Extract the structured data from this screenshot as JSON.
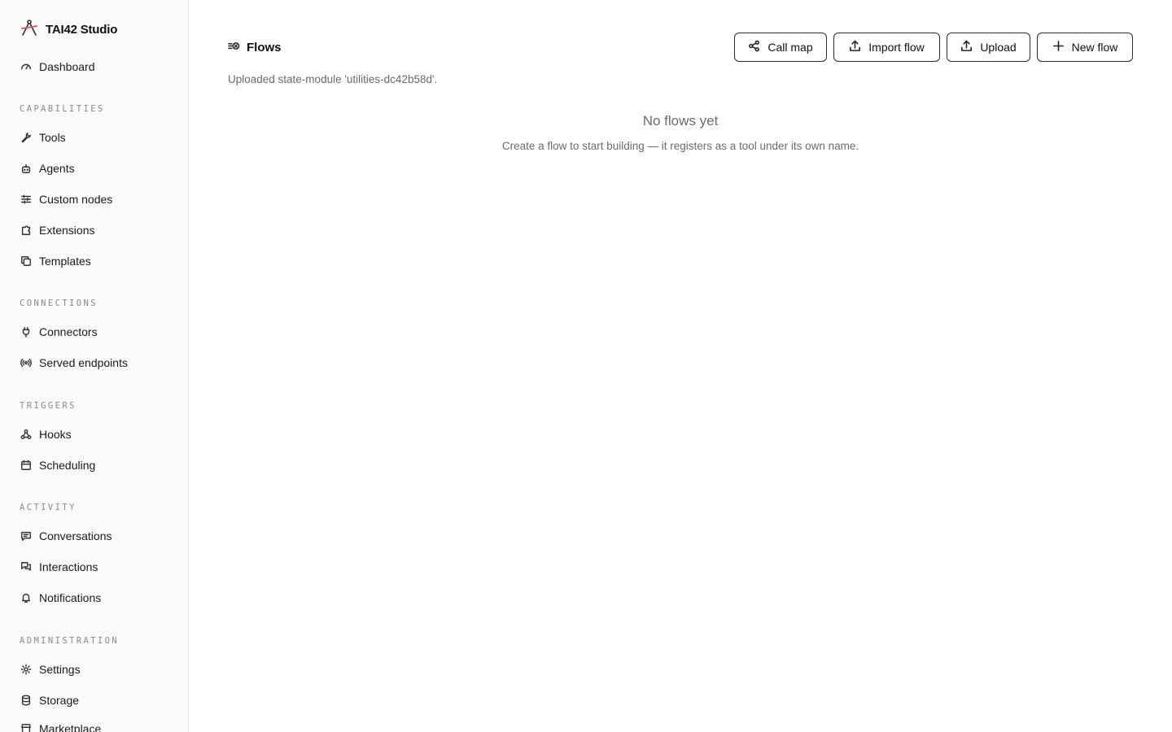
{
  "app": {
    "title": "TAI42 Studio",
    "logo_icon": "compass-logo-icon",
    "accent_color": "#d9534f"
  },
  "sidebar": {
    "dashboard": {
      "label": "Dashboard",
      "icon": "gauge-icon"
    },
    "sections": [
      {
        "heading": "CAPABILITIES",
        "items": [
          {
            "label": "Tools",
            "icon": "wrench-icon"
          },
          {
            "label": "Agents",
            "icon": "robot-icon"
          },
          {
            "label": "Custom nodes",
            "icon": "sliders-icon"
          },
          {
            "label": "Extensions",
            "icon": "puzzle-icon"
          },
          {
            "label": "Templates",
            "icon": "copy-icon"
          }
        ]
      },
      {
        "heading": "CONNECTIONS",
        "items": [
          {
            "label": "Connectors",
            "icon": "plug-icon"
          },
          {
            "label": "Served endpoints",
            "icon": "broadcast-icon"
          }
        ]
      },
      {
        "heading": "TRIGGERS",
        "items": [
          {
            "label": "Hooks",
            "icon": "webhook-icon"
          },
          {
            "label": "Scheduling",
            "icon": "calendar-icon"
          }
        ]
      },
      {
        "heading": "ACTIVITY",
        "items": [
          {
            "label": "Conversations",
            "icon": "message-square-icon"
          },
          {
            "label": "Interactions",
            "icon": "messages-icon"
          },
          {
            "label": "Notifications",
            "icon": "bell-icon"
          }
        ]
      },
      {
        "heading": "ADMINISTRATION",
        "items": [
          {
            "label": "Settings",
            "icon": "gear-icon"
          },
          {
            "label": "Storage",
            "icon": "database-icon"
          },
          {
            "label": "Marketplace",
            "icon": "store-icon"
          }
        ]
      }
    ]
  },
  "header": {
    "title": "Flows",
    "title_icon": "flows-icon",
    "buttons": {
      "call_map": {
        "label": "Call map",
        "icon": "share-icon"
      },
      "import_flow": {
        "label": "Import flow",
        "icon": "upload-icon"
      },
      "upload": {
        "label": "Upload",
        "icon": "upload-icon"
      },
      "new_flow": {
        "label": "New flow",
        "icon": "plus-icon"
      }
    }
  },
  "status_message": "Uploaded state-module 'utilities-dc42b58d'.",
  "empty_state": {
    "title": "No flows yet",
    "description": "Create a flow to start building — it registers as a tool under its own name."
  }
}
